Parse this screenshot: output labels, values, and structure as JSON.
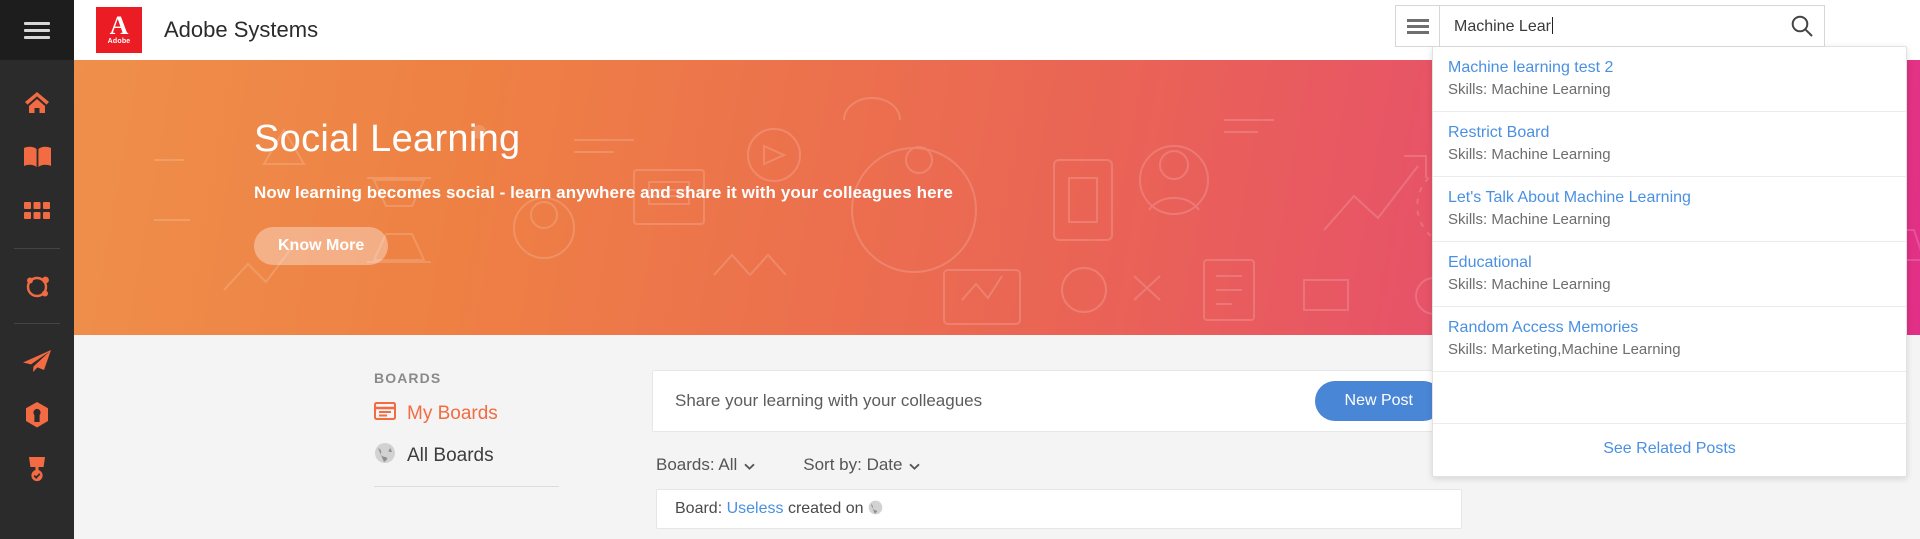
{
  "colors": {
    "accent_orange": "#f26b42",
    "adobe_red": "#ec1c24",
    "link_blue": "#4a90e2",
    "button_blue": "#4a86d6",
    "banner_start": "#ef8f4b",
    "banner_end": "#e12f87",
    "rail_bg": "#2b2b2b"
  },
  "rail": {
    "menu_icon": "hamburger-menu-icon",
    "items": [
      {
        "icon": "home-icon",
        "name": "home"
      },
      {
        "icon": "book-icon",
        "name": "learning"
      },
      {
        "icon": "grid-icon",
        "name": "catalog"
      },
      {
        "icon": "social-share-icon",
        "name": "social-learning"
      },
      {
        "icon": "paper-plane-icon",
        "name": "send"
      },
      {
        "icon": "badge-icon",
        "name": "skills"
      },
      {
        "icon": "trophy-icon",
        "name": "achievements"
      }
    ]
  },
  "header": {
    "logo_mark": "A",
    "logo_wordmark": "Adobe",
    "title": "Adobe Systems"
  },
  "search": {
    "filter_icon": "hamburger-menu-icon",
    "value": "Machine Lear",
    "search_icon": "magnifier-icon"
  },
  "suggestions": {
    "items": [
      {
        "title": "Machine learning test 2",
        "subtitle": "Skills: Machine Learning"
      },
      {
        "title": "Restrict Board",
        "subtitle": "Skills: Machine Learning"
      },
      {
        "title": "Let's Talk About Machine Learning",
        "subtitle": "Skills: Machine Learning"
      },
      {
        "title": "Educational",
        "subtitle": "Skills: Machine Learning"
      },
      {
        "title": "Random Access Memories",
        "subtitle": "Skills: Marketing,Machine Learning"
      }
    ],
    "footer_label": "See Related Posts"
  },
  "banner": {
    "heading": "Social Learning",
    "subheading": "Now learning becomes social - learn anywhere and share it with your colleagues here",
    "cta_label": "Know More"
  },
  "boards": {
    "section_label": "BOARDS",
    "items": [
      {
        "label": "My Boards",
        "icon": "board-icon",
        "active": true
      },
      {
        "label": "All Boards",
        "icon": "globe-icon",
        "active": false
      }
    ]
  },
  "feed": {
    "composer_placeholder": "Share your learning with your colleagues",
    "new_post_label": "New Post",
    "filters": [
      {
        "label": "Boards: All",
        "icon": "chevron-down-icon"
      },
      {
        "label": "Sort by: Date",
        "icon": "chevron-down-icon"
      }
    ],
    "first_post": {
      "prefix": "Board:",
      "link": "Useless",
      "suffix": "created on",
      "icon": "globe-icon"
    }
  }
}
